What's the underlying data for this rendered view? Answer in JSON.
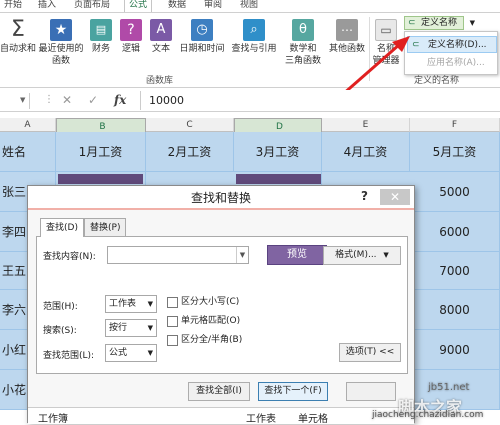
{
  "ribbon_tabs": [
    {
      "label": "开始"
    },
    {
      "label": "插入"
    },
    {
      "label": "页面布局"
    },
    {
      "label": "公式",
      "active": true
    },
    {
      "label": "数据"
    },
    {
      "label": "审阅"
    },
    {
      "label": "视图"
    }
  ],
  "ribbon": {
    "buttons": [
      {
        "line1": "自动求和",
        "icon": "sigma-icon"
      },
      {
        "line1": "最近使用的",
        "line2": "函数",
        "icon": "star-icon"
      },
      {
        "line1": "财务",
        "icon": "finance-book-icon"
      },
      {
        "line1": "逻辑",
        "icon": "question-book-icon"
      },
      {
        "line1": "文本",
        "icon": "text-book-icon"
      },
      {
        "line1": "日期和时间",
        "icon": "clock-book-icon"
      },
      {
        "line1": "查找与引用",
        "icon": "lookup-book-icon"
      },
      {
        "line1": "数学和",
        "line2": "三角函数",
        "icon": "theta-book-icon"
      },
      {
        "line1": "其他函数",
        "icon": "more-book-icon"
      },
      {
        "line1": "名称",
        "line2": "管理器",
        "icon": "name-manager-icon"
      }
    ],
    "group_function_library": "函数库",
    "group_defined_names": "定义的名称",
    "define_name_label": "定义名称",
    "menu": {
      "item1": "定义名称(D)...",
      "item2": "应用名称(A)..."
    }
  },
  "formula_bar": {
    "fx": "fx",
    "value": "10000"
  },
  "sheet": {
    "columns": [
      "A",
      "B",
      "C",
      "D",
      "E",
      "F"
    ],
    "header_row": [
      "姓名",
      "1月工资",
      "2月工资",
      "3月工资",
      "4月工资",
      "5月工资"
    ],
    "rows": [
      {
        "name": "张三",
        "may": "5000"
      },
      {
        "name": "李四",
        "may": "6000"
      },
      {
        "name": "王五",
        "may": "7000"
      },
      {
        "name": "李六",
        "may": "8000"
      },
      {
        "name": "小红",
        "may": "9000"
      },
      {
        "name": "小花",
        "may": ""
      }
    ],
    "highlight_color": "#604a7b"
  },
  "dialog": {
    "title": "查找和替换",
    "help": "?",
    "close": "✕",
    "tab_find": "查找(D)",
    "tab_replace": "替换(P)",
    "find_label": "查找内容(N):",
    "find_value": "",
    "preview": "预览",
    "format_btn": "格式(M)...",
    "within_label": "范围(H):",
    "within_value": "工作表",
    "search_label": "搜索(S):",
    "search_value": "按行",
    "lookin_label": "查找范围(L):",
    "lookin_value": "公式",
    "match_case": "区分大小写(C)",
    "match_cell": "单元格匹配(O)",
    "match_width": "区分全/半角(B)",
    "options_btn": "选项(T) <<",
    "find_all": "查找全部(I)",
    "find_next": "查找下一个(F)",
    "col_workbook": "工作簿",
    "col_sheet": "工作表",
    "col_cell": "单元格"
  },
  "watermark": {
    "line1": "jb51.net",
    "line2": "脚本之家",
    "line3": "jiaocheng.chazidian.com"
  },
  "colors": {
    "accent": "#217346",
    "arrow": "#e02020",
    "row_blue": "#bdd7ee",
    "preview_purple": "#8064a2"
  }
}
